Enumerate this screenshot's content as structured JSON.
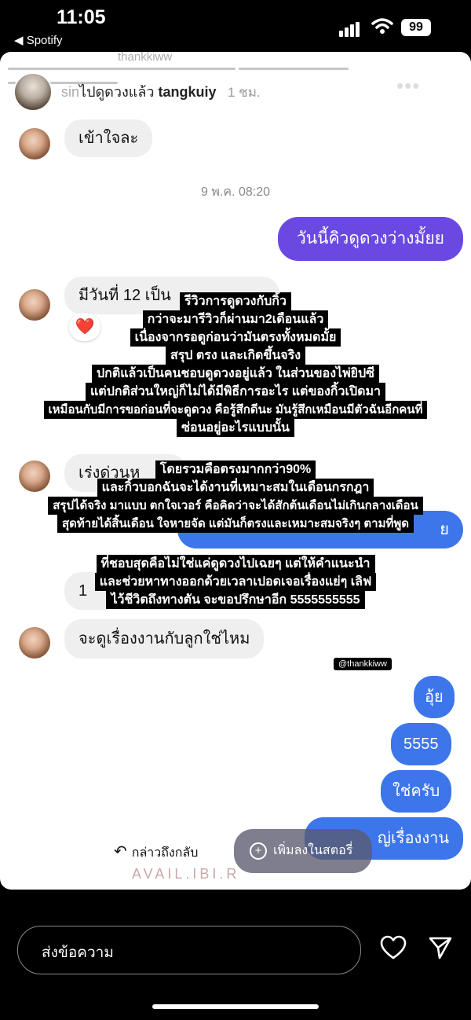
{
  "status_bar": {
    "time": "11:05",
    "back_app": "◀ Spotify",
    "battery": "99"
  },
  "story_header": {
    "username_faded": "sin",
    "username_overlap": "ไปดูดวงแล้ว",
    "username": "tangkuiy",
    "time_ago": "1 ชม.",
    "top_ghost": "thankkiww"
  },
  "chat": {
    "incoming_top": "เข้าใจละ",
    "date_separator": "9 พ.ค. 08:20",
    "outgoing_purple": "วันนี้คิวดูดวงว่างมั้ยย",
    "incoming_12": "มีวันที่ 12 เป็น",
    "reaction": "❤️",
    "incoming_hurry": "เร่งด่วนห",
    "incoming_partial": "1",
    "incoming_work": "จะดูเรื่องงานกับลูกใช่ไหม",
    "outgoing_partial": "ย",
    "outgoing_1": "อุ้ย",
    "outgoing_2": "5555",
    "outgoing_3": "ใช่ครับ",
    "outgoing_4": "ญ่เรื่องงาน"
  },
  "caption_block_1": [
    "รีวิวการดูดวงกับกิ้ว",
    "กว่าจะมารีวิวก็ผ่านมา2เดือนแล้ว",
    "เนื่องจากรอดูก่อนว่ามันตรงทั้งหมดมั้ย",
    "สรุป ตรง และเกิดขึ้นจริง",
    "ปกติแล้วเป็นคนชอบดูดวงอยู่แล้ว ในส่วนของไพ่ยิปซี",
    "แต่ปกติส่วนใหญ่ก็ไม่ได้มีพิธีการอะไร แต่ของกิ้วเปิดมา",
    "เหมือนกับมีการขอก่อนที่จะดูดวง คือรู้สึกดีนะ มันรู้สึกเหมือนมีตัวฉันอีกคนที่",
    "ซ่อนอยู่อะไรแบบนั้น"
  ],
  "caption_block_2": [
    "โดยรวมคือตรงมากกว่า90%",
    "และกิ้วบอกฉันจะได้งานที่เหมาะสมในเดือนกรกฎา",
    "สรุปได้จริง มาแบบ ตกใจเวอร์ คือคิดว่าจะได้สักต้นเดือนไม่เกินกลางเดือน",
    "สุดท้ายได้สิ้นเดือน ใจหายจัด แต่มันก็ตรงและเหมาะสมจริงๆ ตามที่พูด"
  ],
  "caption_block_3": [
    "ที่ชอบสุดคือไม่ใช่แค่ดูดวงไปเฉยๆ แต่ให้คำแนะนำ",
    "และช่วยหาทางออกด้วยเวลาเปอดเจอเรื่องแย่ๆ เลิฟ",
    "ไว้ชีวิตถึงทางตัน จะขอปรึกษาอีก 5555555555"
  ],
  "mention_tag": "@thankkiww",
  "actions": {
    "reply_label": "กล่าวถึงกลับ",
    "add_story_label": "เพิ่มลงในสตอรี่",
    "ghost_text": "AVAIL.IBI.R"
  },
  "footer": {
    "message_placeholder": "ส่งข้อความ"
  },
  "colors": {
    "outgoing_bubble": "#3c76ea",
    "purple_bubble": "#6a49e3",
    "incoming_bubble": "#efefef"
  }
}
